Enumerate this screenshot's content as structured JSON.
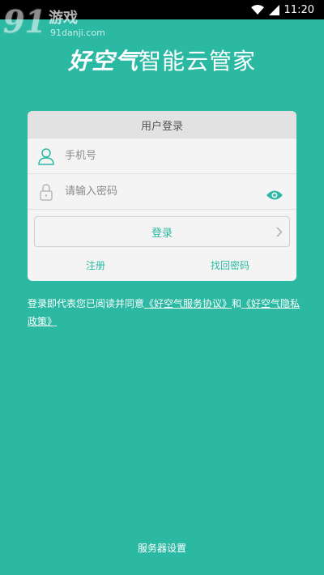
{
  "status_bar": {
    "time": "11:20"
  },
  "watermark": {
    "number": "91",
    "name": "游戏",
    "url": "91danji.com"
  },
  "header": {
    "brand": "好空气",
    "title_rest": "智能云管家"
  },
  "login_card": {
    "title": "用户登录",
    "phone_placeholder": "手机号",
    "password_placeholder": "请输入密码",
    "login_label": "登录",
    "register_label": "注册",
    "forgot_label": "找回密码"
  },
  "agreement": {
    "prefix": "登录即代表您已阅读并同意",
    "service_link": "《好空气服务协议》",
    "conjunction": "和",
    "privacy_link": "《好空气隐私政策》"
  },
  "footer": {
    "server_settings_label": "服务器设置"
  },
  "colors": {
    "primary": "#2bb9a3",
    "card_bg": "#f4f4f4",
    "card_header_bg": "#e2e2e2"
  }
}
